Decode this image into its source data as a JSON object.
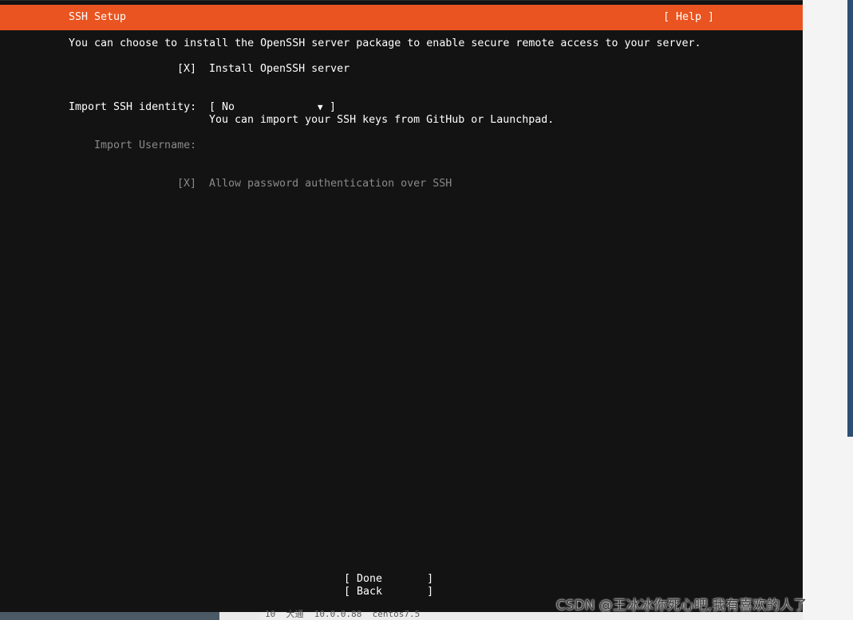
{
  "header": {
    "title": "SSH Setup",
    "help": "[ Help ]"
  },
  "intro": "You can choose to install the OpenSSH server package to enable secure remote access to your server.",
  "install_openssh": {
    "checkbox": "[X]",
    "label": "Install OpenSSH server"
  },
  "import_identity": {
    "label": "Import SSH identity:",
    "select_open": "[ No",
    "select_arrow": "▼",
    "select_close": "]",
    "help": "You can import your SSH keys from GitHub or Launchpad."
  },
  "import_username": {
    "label": "Import Username:"
  },
  "allow_password": {
    "checkbox": "[X]",
    "label": "Allow password authentication over SSH"
  },
  "buttons": {
    "done": "[ Done       ]",
    "back": "[ Back       ]"
  },
  "taskbar_peek": "10  大通  10.0.0.88  centos7.5",
  "watermark": "CSDN @王冰冰你死心吧,我有喜欢的人了",
  "colors": {
    "header_bg": "#e95420",
    "background": "#131313",
    "text": "#ffffff",
    "dim_text": "#8a8a8a"
  }
}
